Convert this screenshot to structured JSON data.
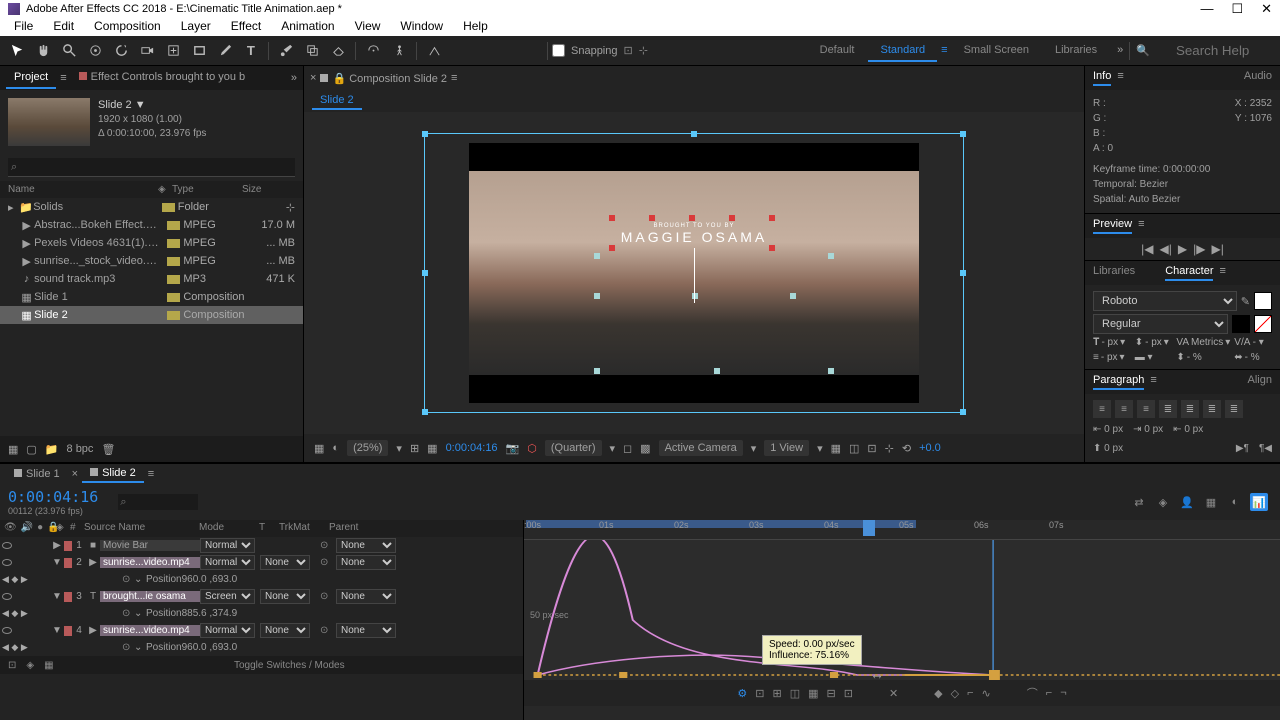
{
  "titlebar": {
    "text": "Adobe After Effects CC 2018 - E:\\Cinematic Title Animation.aep *"
  },
  "menu": [
    "File",
    "Edit",
    "Composition",
    "Layer",
    "Effect",
    "Animation",
    "View",
    "Window",
    "Help"
  ],
  "toolbar": {
    "snapping": "Snapping",
    "workspaces": [
      "Default",
      "Standard",
      "Small Screen",
      "Libraries"
    ],
    "active_ws": "Standard",
    "search_placeholder": "Search Help"
  },
  "project": {
    "tab1": "Project",
    "tab2": "Effect Controls brought to you b",
    "info_name": "Slide 2 ▼",
    "info_res": "1920 x 1080 (1.00)",
    "info_dur": "Δ 0:00:10:00, 23.976 fps",
    "cols": {
      "name": "Name",
      "type": "Type",
      "size": "Size"
    },
    "items": [
      {
        "name": "Solids",
        "type": "Folder",
        "size": "",
        "icon": "folder"
      },
      {
        "name": "Abstrac...Bokeh Effect.mp4",
        "type": "MPEG",
        "size": "17.0 M",
        "icon": "video"
      },
      {
        "name": "Pexels Videos 4631(1).mp4",
        "type": "MPEG",
        "size": "... MB",
        "icon": "video"
      },
      {
        "name": "sunrise..._stock_video.mp4",
        "type": "MPEG",
        "size": "... MB",
        "icon": "video"
      },
      {
        "name": "sound track.mp3",
        "type": "MP3",
        "size": "471 K",
        "icon": "audio"
      },
      {
        "name": "Slide 1",
        "type": "Composition",
        "size": "",
        "icon": "comp"
      },
      {
        "name": "Slide 2",
        "type": "Composition",
        "size": "",
        "icon": "comp",
        "selected": true
      }
    ],
    "bpc": "8 bpc"
  },
  "composition": {
    "title": "Composition Slide 2",
    "subtab": "Slide 2",
    "overlay_small": "BROUGHT TO YOU BY",
    "overlay_big": "MAGGIE OSAMA",
    "zoom": "(25%)",
    "timecode": "0:00:04:16",
    "quality": "(Quarter)",
    "camera": "Active Camera",
    "view": "1 View",
    "exposure": "+0.0"
  },
  "right": {
    "info": {
      "tab": "Info",
      "audio_tab": "Audio",
      "R": "R :",
      "G": "G :",
      "B": "B :",
      "A": "A : 0",
      "X": "X : 2352",
      "Y": "Y : 1076",
      "kf": "Keyframe time: 0:00:00:00",
      "temporal": "Temporal: Bezier",
      "spatial": "Spatial: Auto Bezier"
    },
    "preview": {
      "tab": "Preview"
    },
    "libraries": {
      "tab1": "Libraries",
      "tab2": "Character"
    },
    "char": {
      "font": "Roboto",
      "weight": "Regular",
      "px": "- px",
      "metrics": "Metrics",
      "pct": "- %"
    },
    "paragraph": {
      "tab1": "Paragraph",
      "tab2": "Align",
      "px": "0 px"
    }
  },
  "timeline": {
    "tabs": [
      "Slide 1",
      "Slide 2"
    ],
    "active_tab": 1,
    "time": "0:00:04:16",
    "frame": "00112 (23.976 fps)",
    "cols": {
      "num": "#",
      "src": "Source Name",
      "mode": "Mode",
      "t": "T",
      "trk": "TrkMat",
      "parent": "Parent"
    },
    "layers": [
      {
        "n": 1,
        "color": "#b85a5a",
        "name": "Movie Bar",
        "mode": "Normal",
        "type": "solid"
      },
      {
        "n": 2,
        "color": "#b85a5a",
        "name": "sunrise...video.mp4",
        "mode": "Normal",
        "type": "video",
        "selected": true,
        "props": [
          {
            "name": "Position",
            "val": "960.0 ,693.0"
          }
        ]
      },
      {
        "n": 3,
        "color": "#b85a5a",
        "name": "brought...ie osama",
        "mode": "Screen",
        "type": "text",
        "selected": true,
        "props": [
          {
            "name": "Position",
            "val": "885.6 ,374.9"
          }
        ]
      },
      {
        "n": 4,
        "color": "#b85a5a",
        "name": "sunrise...video.mp4",
        "mode": "Normal",
        "type": "video",
        "selected": true,
        "props": [
          {
            "name": "Position",
            "val": "960.0 ,693.0"
          }
        ]
      }
    ],
    "none": "None",
    "ruler_labels": [
      ":00s",
      "01s",
      "02s",
      "03s",
      "04s",
      "05s",
      "06s",
      "07s"
    ],
    "graph_label": "50 px/sec",
    "tooltip": {
      "line1": "Speed: 0.00 px/sec",
      "line2": "Influence: 75.16%"
    },
    "toggle": "Toggle Switches / Modes"
  }
}
